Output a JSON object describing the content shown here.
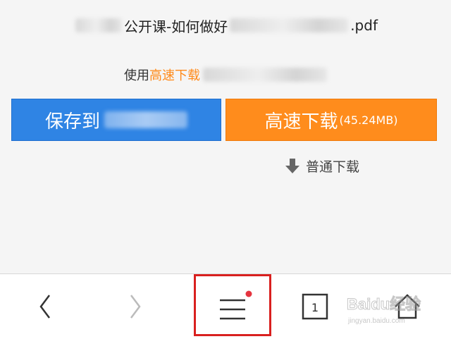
{
  "file": {
    "title_mid": "公开课-如何做好",
    "title_ext": ".pdf"
  },
  "hint": {
    "prefix": "使用",
    "accent": "高速下载"
  },
  "buttons": {
    "save_label": "保存到",
    "fast_label": "高速下载",
    "fast_size": "(45.24MB)",
    "normal_label": "普通下载"
  },
  "bottom_nav": {
    "tab_count": "1",
    "menu_badge_color": "#e5343f"
  },
  "colors": {
    "save_button": "#2f84e4",
    "fast_button": "#ff8c1c",
    "accent_text": "#ff8a1a",
    "highlight_box": "#d9201f"
  },
  "watermark": {
    "logo": "Baidu经验",
    "sub": "jingyan.baidu.com"
  }
}
